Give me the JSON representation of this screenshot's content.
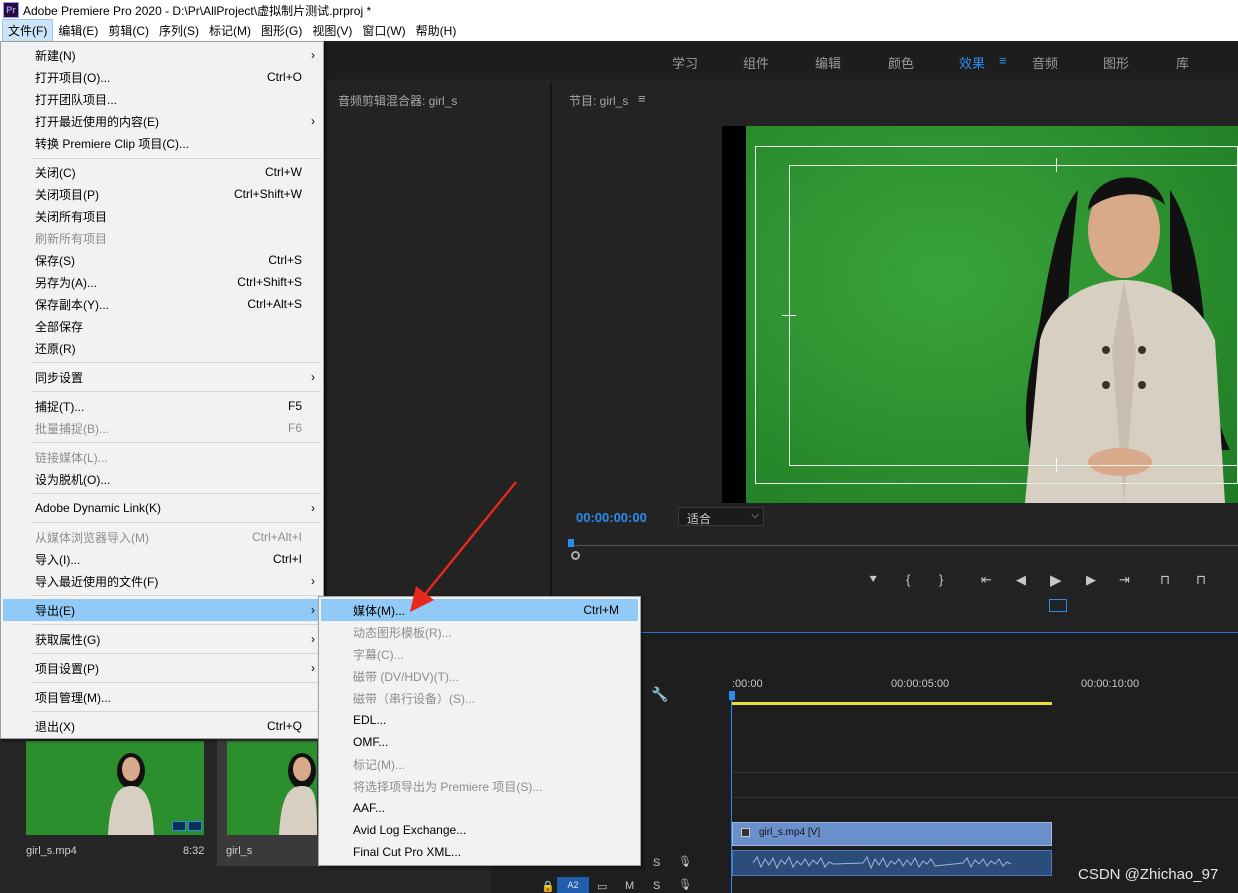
{
  "window": {
    "title": "Adobe Premiere Pro 2020 - D:\\Pr\\AllProject\\虚拟制片测试.prproj *",
    "app_icon": "Pr"
  },
  "menubar": [
    "文件(F)",
    "编辑(E)",
    "剪辑(C)",
    "序列(S)",
    "标记(M)",
    "图形(G)",
    "视图(V)",
    "窗口(W)",
    "帮助(H)"
  ],
  "workspaces": [
    "学习",
    "组件",
    "编辑",
    "颜色",
    "效果",
    "音频",
    "图形",
    "库"
  ],
  "active_workspace": "效果",
  "panels": {
    "mixer_title": "音频剪辑混合器: girl_s",
    "program_title": "节目: girl_s",
    "timecode": "00:00:00:00",
    "fit": "适合",
    "timeline_ticks": [
      ":00:00",
      "00:00:05:00",
      "00:00:10:00"
    ],
    "clip_video": "girl_s.mp4 [V]",
    "track_a2": "A2"
  },
  "file_menu": [
    {
      "label": "新建(N)",
      "shortcut": "",
      "submenu": true,
      "disabled": false
    },
    {
      "label": "打开项目(O)...",
      "shortcut": "Ctrl+O",
      "submenu": false,
      "disabled": false
    },
    {
      "label": "打开团队项目...",
      "shortcut": "",
      "submenu": false,
      "disabled": false
    },
    {
      "label": "打开最近使用的内容(E)",
      "shortcut": "",
      "submenu": true,
      "disabled": false
    },
    {
      "label": "转换 Premiere Clip 项目(C)...",
      "shortcut": "",
      "submenu": false,
      "disabled": false
    },
    {
      "label": "关闭(C)",
      "shortcut": "Ctrl+W",
      "submenu": false,
      "disabled": false
    },
    {
      "label": "关闭项目(P)",
      "shortcut": "Ctrl+Shift+W",
      "submenu": false,
      "disabled": false
    },
    {
      "label": "关闭所有项目",
      "shortcut": "",
      "submenu": false,
      "disabled": false
    },
    {
      "label": "刷新所有项目",
      "shortcut": "",
      "submenu": false,
      "disabled": true
    },
    {
      "label": "保存(S)",
      "shortcut": "Ctrl+S",
      "submenu": false,
      "disabled": false
    },
    {
      "label": "另存为(A)...",
      "shortcut": "Ctrl+Shift+S",
      "submenu": false,
      "disabled": false
    },
    {
      "label": "保存副本(Y)...",
      "shortcut": "Ctrl+Alt+S",
      "submenu": false,
      "disabled": false
    },
    {
      "label": "全部保存",
      "shortcut": "",
      "submenu": false,
      "disabled": false
    },
    {
      "label": "还原(R)",
      "shortcut": "",
      "submenu": false,
      "disabled": false
    },
    {
      "label": "同步设置",
      "shortcut": "",
      "submenu": true,
      "disabled": false
    },
    {
      "label": "捕捉(T)...",
      "shortcut": "F5",
      "submenu": false,
      "disabled": false
    },
    {
      "label": "批量捕捉(B)...",
      "shortcut": "F6",
      "submenu": false,
      "disabled": true
    },
    {
      "label": "链接媒体(L)...",
      "shortcut": "",
      "submenu": false,
      "disabled": true
    },
    {
      "label": "设为脱机(O)...",
      "shortcut": "",
      "submenu": false,
      "disabled": false
    },
    {
      "label": "Adobe Dynamic Link(K)",
      "shortcut": "",
      "submenu": true,
      "disabled": false
    },
    {
      "label": "从媒体浏览器导入(M)",
      "shortcut": "Ctrl+Alt+I",
      "submenu": false,
      "disabled": true
    },
    {
      "label": "导入(I)...",
      "shortcut": "Ctrl+I",
      "submenu": false,
      "disabled": false
    },
    {
      "label": "导入最近使用的文件(F)",
      "shortcut": "",
      "submenu": true,
      "disabled": false
    },
    {
      "label": "导出(E)",
      "shortcut": "",
      "submenu": true,
      "disabled": false,
      "highlighted": true
    },
    {
      "label": "获取属性(G)",
      "shortcut": "",
      "submenu": true,
      "disabled": false
    },
    {
      "label": "项目设置(P)",
      "shortcut": "",
      "submenu": true,
      "disabled": false
    },
    {
      "label": "项目管理(M)...",
      "shortcut": "",
      "submenu": false,
      "disabled": false
    },
    {
      "label": "退出(X)",
      "shortcut": "Ctrl+Q",
      "submenu": false,
      "disabled": false
    }
  ],
  "export_menu": [
    {
      "label": "媒体(M)...",
      "shortcut": "Ctrl+M",
      "disabled": false,
      "highlighted": true
    },
    {
      "label": "动态图形模板(R)...",
      "shortcut": "",
      "disabled": true
    },
    {
      "label": "字幕(C)...",
      "shortcut": "",
      "disabled": true
    },
    {
      "label": "磁带 (DV/HDV)(T)...",
      "shortcut": "",
      "disabled": true
    },
    {
      "label": "磁带（串行设备）(S)...",
      "shortcut": "",
      "disabled": true
    },
    {
      "label": "EDL...",
      "shortcut": "",
      "disabled": false
    },
    {
      "label": "OMF...",
      "shortcut": "",
      "disabled": false
    },
    {
      "label": "标记(M)...",
      "shortcut": "",
      "disabled": true
    },
    {
      "label": "将选择项导出为 Premiere 项目(S)...",
      "shortcut": "",
      "disabled": true
    },
    {
      "label": "AAF...",
      "shortcut": "",
      "disabled": false
    },
    {
      "label": "Avid Log Exchange...",
      "shortcut": "",
      "disabled": false
    },
    {
      "label": "Final Cut Pro XML...",
      "shortcut": "",
      "disabled": false
    }
  ],
  "bin": {
    "item1_name": "girl_s.mp4",
    "item1_duration": "8:32",
    "item2_name": "girl_s"
  },
  "watermark": "CSDN @Zhichao_97",
  "colors": {
    "accent": "#2d8ceb",
    "menu_highlight": "#91c9f7",
    "green_screen": "#2b8f2e",
    "arrow": "#e8271f"
  }
}
